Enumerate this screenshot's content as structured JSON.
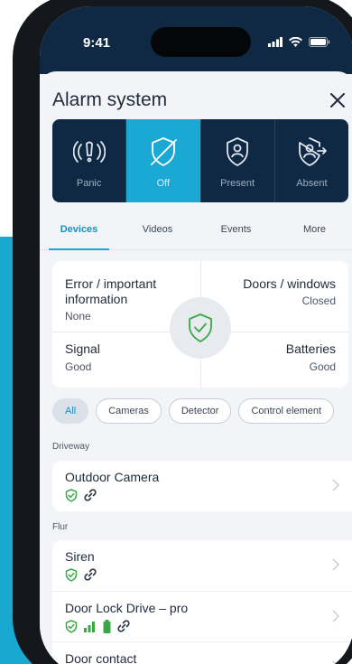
{
  "status_bar": {
    "time": "9:41"
  },
  "header": {
    "title": "Alarm system"
  },
  "modes": [
    {
      "label": "Panic",
      "icon": "panic-icon",
      "active": false
    },
    {
      "label": "Off",
      "icon": "shield-off-icon",
      "active": true
    },
    {
      "label": "Present",
      "icon": "person-shield-icon",
      "active": false
    },
    {
      "label": "Absent",
      "icon": "person-shield-exit-icon",
      "active": false
    }
  ],
  "tabs": [
    {
      "label": "Devices",
      "active": true
    },
    {
      "label": "Videos",
      "active": false
    },
    {
      "label": "Events",
      "active": false
    },
    {
      "label": "More",
      "active": false
    }
  ],
  "summary": {
    "error_title": "Error / important information",
    "error_value": "None",
    "doors_title": "Doors / windows",
    "doors_value": "Closed",
    "signal_title": "Signal",
    "signal_value": "Good",
    "batteries_title": "Batteries",
    "batteries_value": "Good"
  },
  "filters": [
    {
      "label": "All",
      "active": true
    },
    {
      "label": "Cameras",
      "active": false
    },
    {
      "label": "Detector",
      "active": false
    },
    {
      "label": "Control element",
      "active": false
    }
  ],
  "groups": [
    {
      "label": "Driveway",
      "devices": [
        {
          "name": "Outdoor Camera",
          "icons": [
            "shield-check-icon",
            "link-icon"
          ]
        }
      ]
    },
    {
      "label": "Flur",
      "devices": [
        {
          "name": "Siren",
          "icons": [
            "shield-check-icon",
            "link-icon"
          ]
        },
        {
          "name": "Door Lock Drive – pro",
          "icons": [
            "shield-check-icon",
            "signal-icon",
            "battery-icon",
            "link-icon"
          ]
        },
        {
          "name": "Door contact",
          "icons": [
            "shield-check-icon",
            "signal-icon",
            "battery-icon",
            "link-icon"
          ]
        }
      ]
    }
  ],
  "colors": {
    "navy": "#0f2944",
    "accent": "#1ba8d3",
    "ok_green": "#3aa845"
  }
}
